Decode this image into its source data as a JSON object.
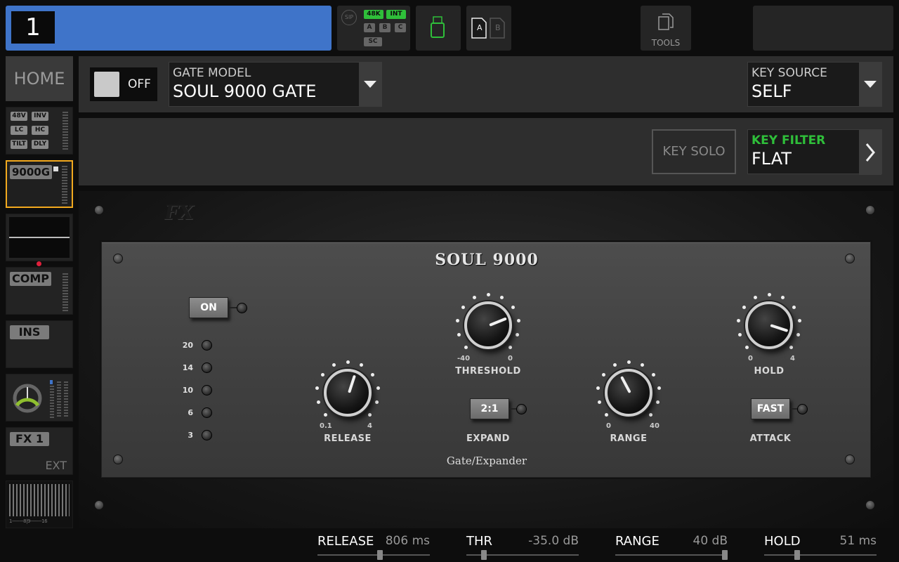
{
  "header": {
    "channel_number": "1",
    "status": {
      "sip": "SIP",
      "rate": "48K",
      "clock": "INT",
      "a": "A",
      "b": "B",
      "c": "C",
      "sc": "SC"
    },
    "ab_labels": {
      "a": "A",
      "b": "B"
    },
    "tools_label": "TOOLS"
  },
  "sidebar": {
    "home": "HOME",
    "input": {
      "b48v": "48V",
      "inv": "INV",
      "lc": "LC",
      "hc": "HC",
      "tilt": "TILT",
      "dly": "DLY"
    },
    "gate": "9000G",
    "comp": "COMP",
    "ins": "INS",
    "fx": "FX 1",
    "fx_ext": "EXT",
    "meter_scale": "1--------8|9--------16"
  },
  "model_panel": {
    "toggle_label": "OFF",
    "gate_model_caption": "GATE MODEL",
    "gate_model_value": "SOUL 9000 GATE",
    "key_source_caption": "KEY SOURCE",
    "key_source_value": "SELF"
  },
  "key_panel": {
    "key_solo": "KEY SOLO",
    "key_filter_caption": "KEY FILTER",
    "key_filter_value": "FLAT"
  },
  "plugin": {
    "logo": "FX",
    "title": "SOUL 9000",
    "subtitle": "Gate/Expander",
    "on_button": "ON",
    "meter_leds": [
      "20",
      "14",
      "10",
      "6",
      "3"
    ],
    "threshold": {
      "label": "THRESHOLD",
      "min": "-40",
      "max": "0",
      "angle": -112
    },
    "release": {
      "label": "RELEASE",
      "min": "0.1",
      "max": "4",
      "angle": 198
    },
    "range": {
      "label": "RANGE",
      "min": "0",
      "max": "40",
      "angle": 152
    },
    "hold": {
      "label": "HOLD",
      "min": "0",
      "max": "4",
      "angle": -72
    },
    "expand": {
      "button": "2:1",
      "label": "EXPAND"
    },
    "attack": {
      "button": "FAST",
      "label": "ATTACK"
    }
  },
  "params": [
    {
      "name": "RELEASE",
      "value": "806 ms",
      "position": 0.56
    },
    {
      "name": "THR",
      "value": "-35.0 dB",
      "position": 0.14
    },
    {
      "name": "RANGE",
      "value": "40 dB",
      "position": 1.0
    },
    {
      "name": "HOLD",
      "value": "51 ms",
      "position": 0.28
    }
  ],
  "colors": {
    "channel_bar": "#3f74c9",
    "selected_outline": "#f2a91e",
    "key_filter_caption": "#2fbf3a"
  }
}
